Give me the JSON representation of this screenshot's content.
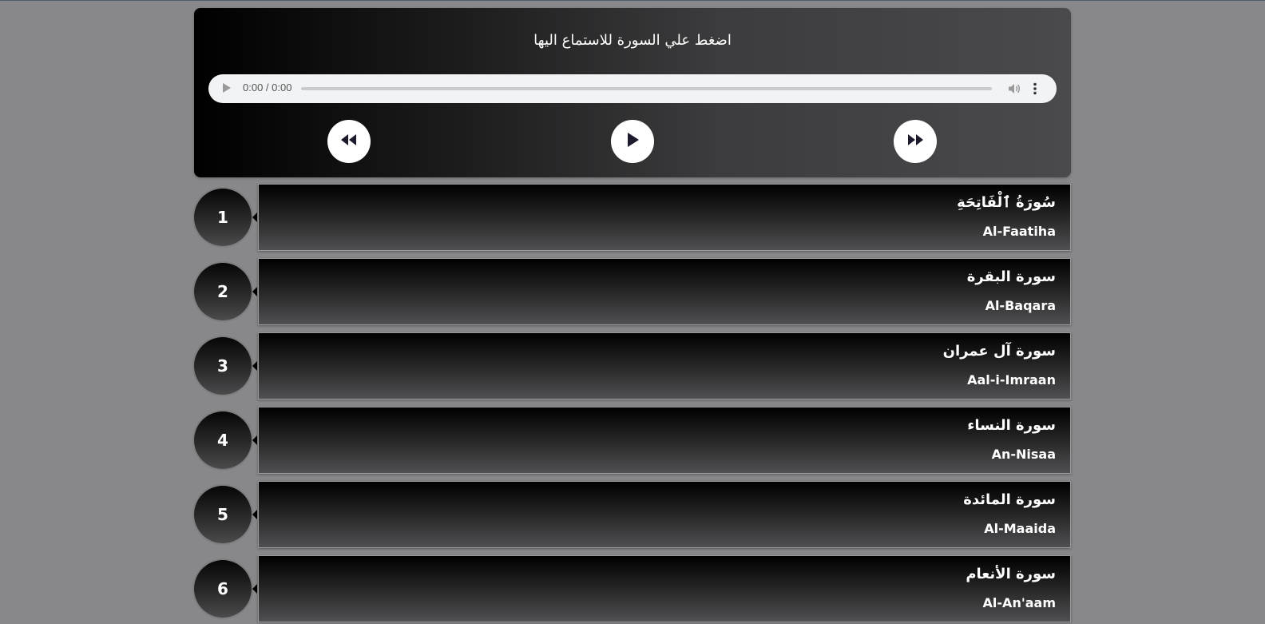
{
  "player": {
    "title": "اضغط علي السورة للاستماع اليها",
    "audio": {
      "time": "0:00 / 0:00"
    },
    "controls": {
      "rewind_icon": "rewind-icon",
      "play_icon": "play-icon",
      "forward_icon": "fast-forward-icon"
    }
  },
  "surahs": [
    {
      "number": "1",
      "arabic": "سُورَةُ ٱلْفَاتِحَةِ",
      "english": "Al-Faatiha"
    },
    {
      "number": "2",
      "arabic": "سورة البقرة",
      "english": "Al-Baqara"
    },
    {
      "number": "3",
      "arabic": "سورة آل عمران",
      "english": "Aal-i-Imraan"
    },
    {
      "number": "4",
      "arabic": "سورة النساء",
      "english": "An-Nisaa"
    },
    {
      "number": "5",
      "arabic": "سورة المائدة",
      "english": "Al-Maaida"
    },
    {
      "number": "6",
      "arabic": "سورة الأنعام",
      "english": "Al-An'aam"
    }
  ],
  "colors": {
    "page_background": "#888789",
    "button_background": "#ffffff",
    "icon_color": "#1d1a2e",
    "text": "#ffffff"
  }
}
